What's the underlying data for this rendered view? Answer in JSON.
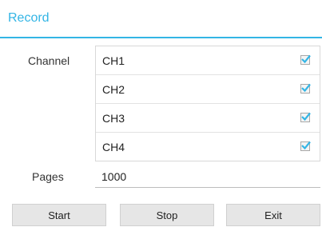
{
  "dialog": {
    "title": "Record"
  },
  "form": {
    "channel_label": "Channel",
    "channels": [
      {
        "name": "CH1",
        "checked": true
      },
      {
        "name": "CH2",
        "checked": true
      },
      {
        "name": "CH3",
        "checked": true
      },
      {
        "name": "CH4",
        "checked": true
      }
    ],
    "pages_label": "Pages",
    "pages_value": "1000"
  },
  "buttons": {
    "start": "Start",
    "stop": "Stop",
    "exit": "Exit"
  },
  "colors": {
    "accent": "#33b5e5",
    "check": "#33b5e5"
  },
  "icons": {
    "checkbox": "checkbox-checked-icon"
  }
}
